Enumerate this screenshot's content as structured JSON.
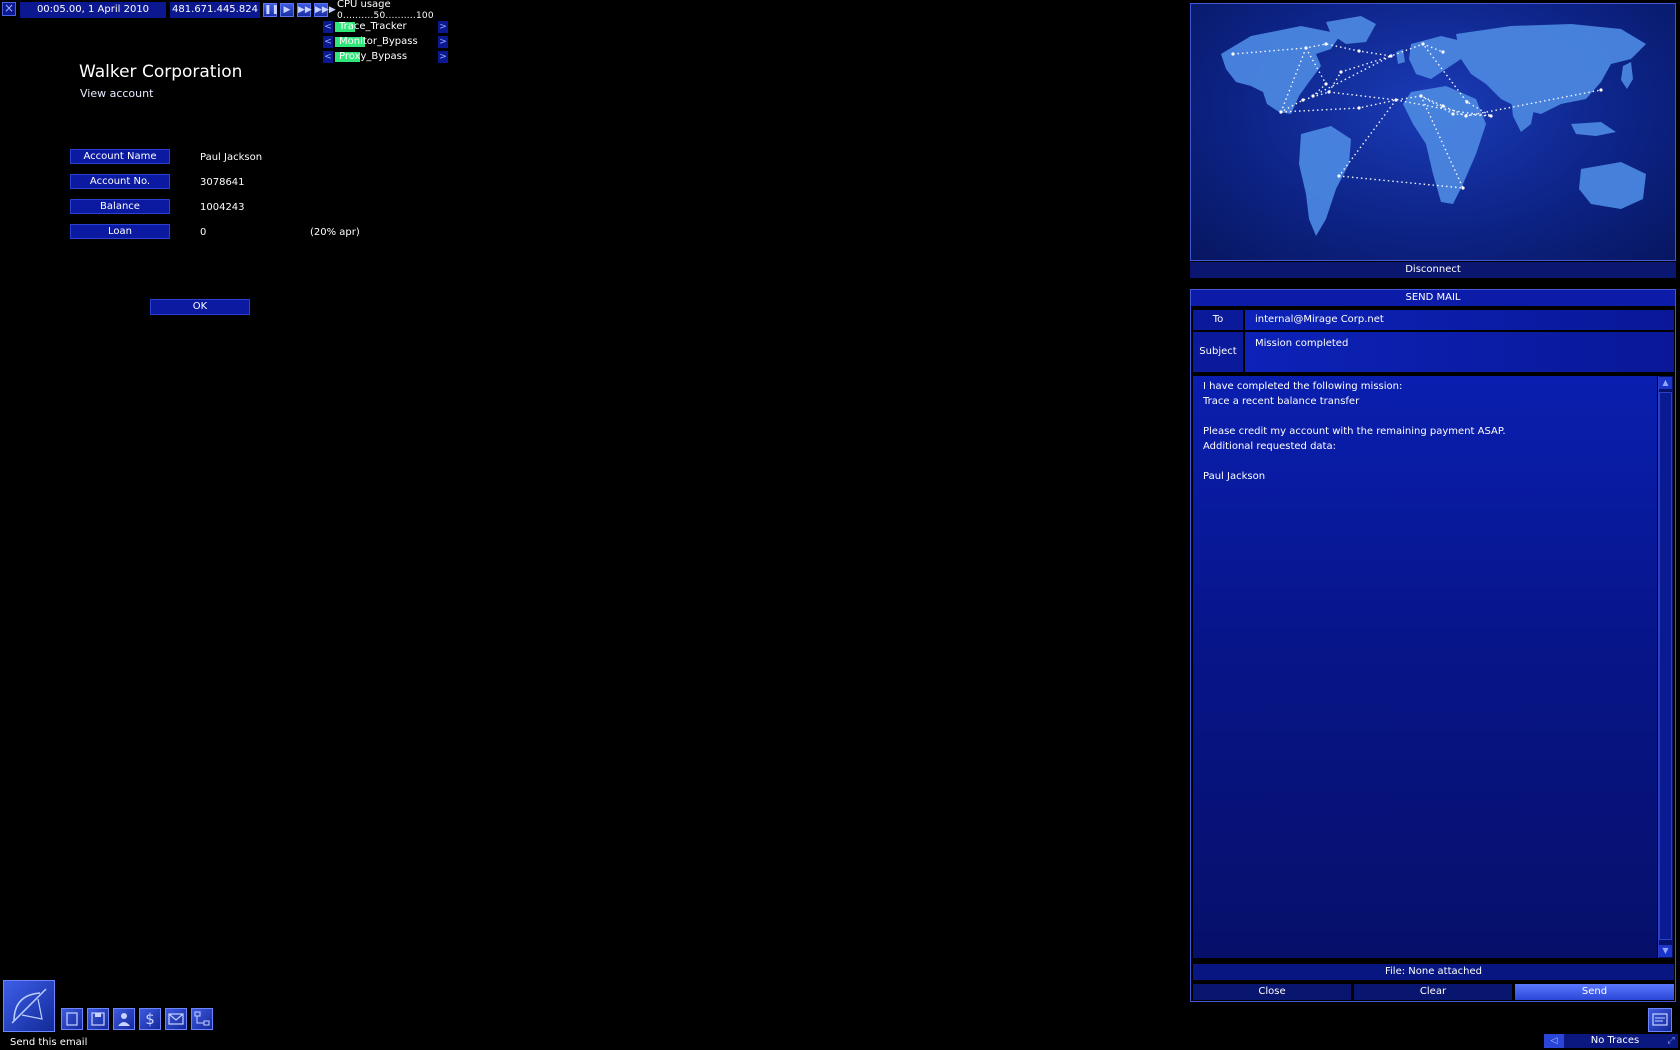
{
  "topbar": {
    "close_icon": "close-x-icon",
    "datetime": "00:05.00, 1 April 2010",
    "ip": "481.671.445.824",
    "speed_buttons": [
      "pause-icon",
      "play-icon",
      "fast-forward-icon",
      "fastest-icon"
    ]
  },
  "cpu": {
    "title": "CPU usage",
    "scale": "0..........50..........100",
    "programs": [
      {
        "name": "Trace_Tracker",
        "usage": 0.2
      },
      {
        "name": "Monitor_Bypass",
        "usage": 0.3
      },
      {
        "name": "Proxy_Bypass",
        "usage": 0.25
      }
    ],
    "left_arrow": "<",
    "right_arrow": ">"
  },
  "bank": {
    "title": "Walker Corporation",
    "subtitle": "View account",
    "fields": [
      {
        "label": "Account Name",
        "value": "Paul Jackson"
      },
      {
        "label": "Account No.",
        "value": "3078641"
      },
      {
        "label": "Balance",
        "value": "1004243"
      },
      {
        "label": "Loan",
        "value": "0"
      }
    ],
    "loan_note": "(20% apr)",
    "ok_label": "OK"
  },
  "map": {
    "disconnect_label": "Disconnect"
  },
  "mail": {
    "header": "SEND MAIL",
    "to_label": "To",
    "to_value": "internal@Mirage Corp.net",
    "subject_label": "Subject",
    "subject_value": "Mission completed",
    "body": "I have completed the following mission:\nTrace a recent balance transfer\n\nPlease credit my account with the remaining payment ASAP.\nAdditional requested data:\n\nPaul Jackson",
    "file_status": "File: None attached",
    "close_label": "Close",
    "clear_label": "Clear",
    "send_label": "Send"
  },
  "status": {
    "text": "Send this email",
    "traces": "No Traces"
  },
  "colors": {
    "panel_blue": "#0c1fa8",
    "accent": "#3f58d8",
    "cpu_green": "#2fe87a"
  }
}
